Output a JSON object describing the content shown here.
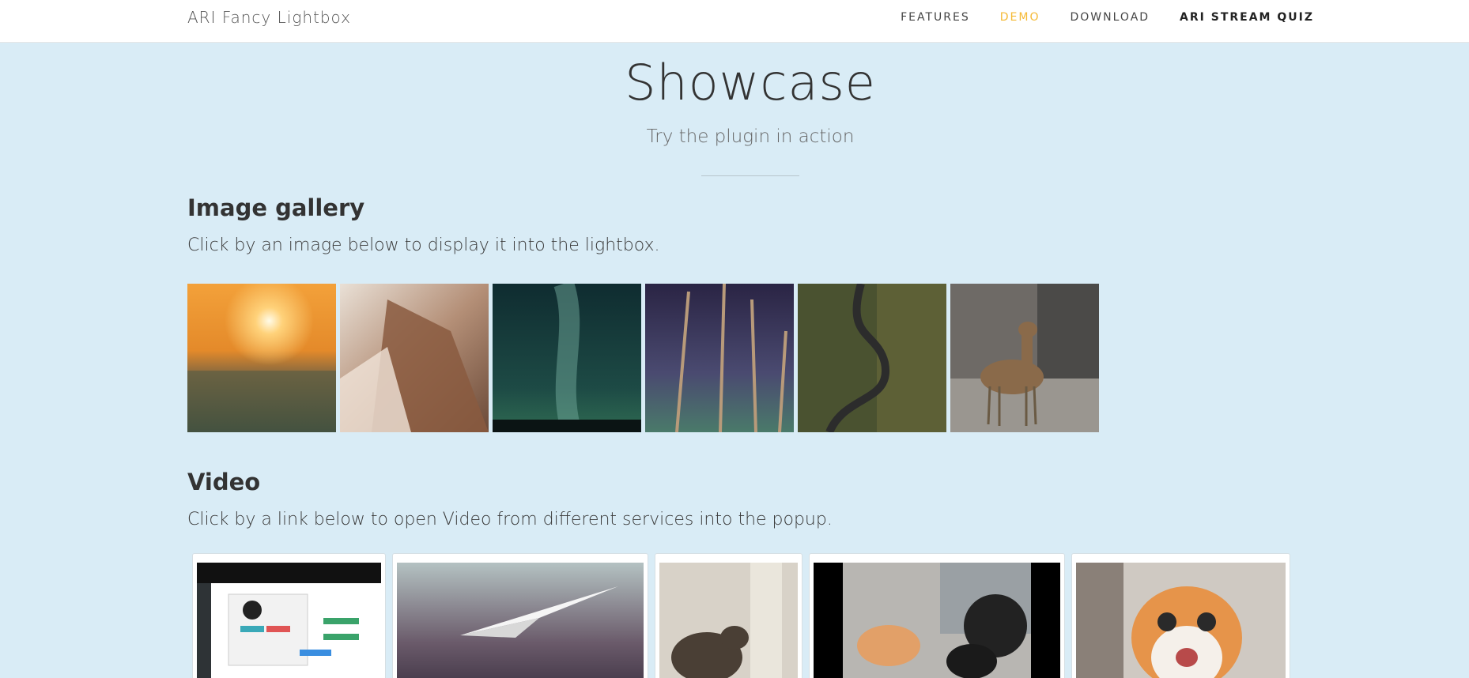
{
  "header": {
    "brand": "ARI Fancy Lightbox",
    "nav": [
      {
        "label": "FEATURES"
      },
      {
        "label": "DEMO"
      },
      {
        "label": "DOWNLOAD"
      },
      {
        "label": "ARI STREAM QUIZ"
      }
    ]
  },
  "hero": {
    "title": "Showcase",
    "subtitle": "Try the plugin in action"
  },
  "gallery_section": {
    "title": "Image gallery",
    "description": "Click by an image below to display it into the lightbox.",
    "images": [
      {
        "name": "sunset-city"
      },
      {
        "name": "misty-mountains"
      },
      {
        "name": "milky-way"
      },
      {
        "name": "tall-trees"
      },
      {
        "name": "winding-road"
      },
      {
        "name": "deer"
      }
    ]
  },
  "video_section": {
    "title": "Video",
    "description": "Click by a link below to open Video from different services into the popup.",
    "videos": [
      {
        "name": "admin-screen-video"
      },
      {
        "name": "paper-plane-video"
      },
      {
        "name": "cat-curtain-video"
      },
      {
        "name": "cat-car-video"
      },
      {
        "name": "surprised-cat-video"
      }
    ]
  },
  "colors": {
    "page_background": "#d9ecf6",
    "header_background": "#ffffff",
    "active_nav": "#f5b935"
  }
}
